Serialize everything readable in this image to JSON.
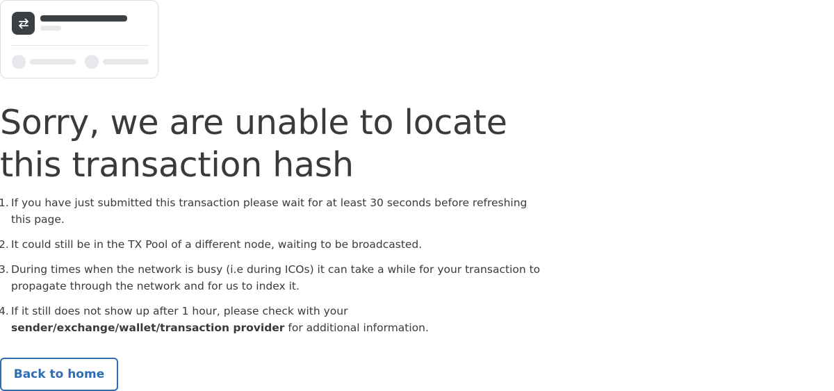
{
  "illustration": {
    "icon": "swap-arrows-icon",
    "icon_bg_color": "#3c3f43"
  },
  "error": {
    "title": "Sorry, we are unable to locate this transaction hash"
  },
  "reasons": [
    {
      "number": "1.",
      "text": "If you have just submitted this transaction please wait for at least 30 seconds before refreshing this page."
    },
    {
      "number": "2.",
      "text": "It could still be in the TX Pool of a different node, waiting to be broadcasted."
    },
    {
      "number": "3.",
      "text": "During times when the network is busy (i.e during ICOs) it can take a while for your transaction to propagate through the network and for us to index it."
    },
    {
      "number": "4.",
      "text_before": "If it still does not show up after 1 hour, please check with your ",
      "text_bold": "sender/exchange/wallet/transaction provider",
      "text_after": " for additional information."
    }
  ],
  "actions": {
    "back_label": "Back to home"
  },
  "colors": {
    "accent": "#2e6db0",
    "text": "#3a3a3a",
    "skeleton": "#e6e8eb"
  }
}
